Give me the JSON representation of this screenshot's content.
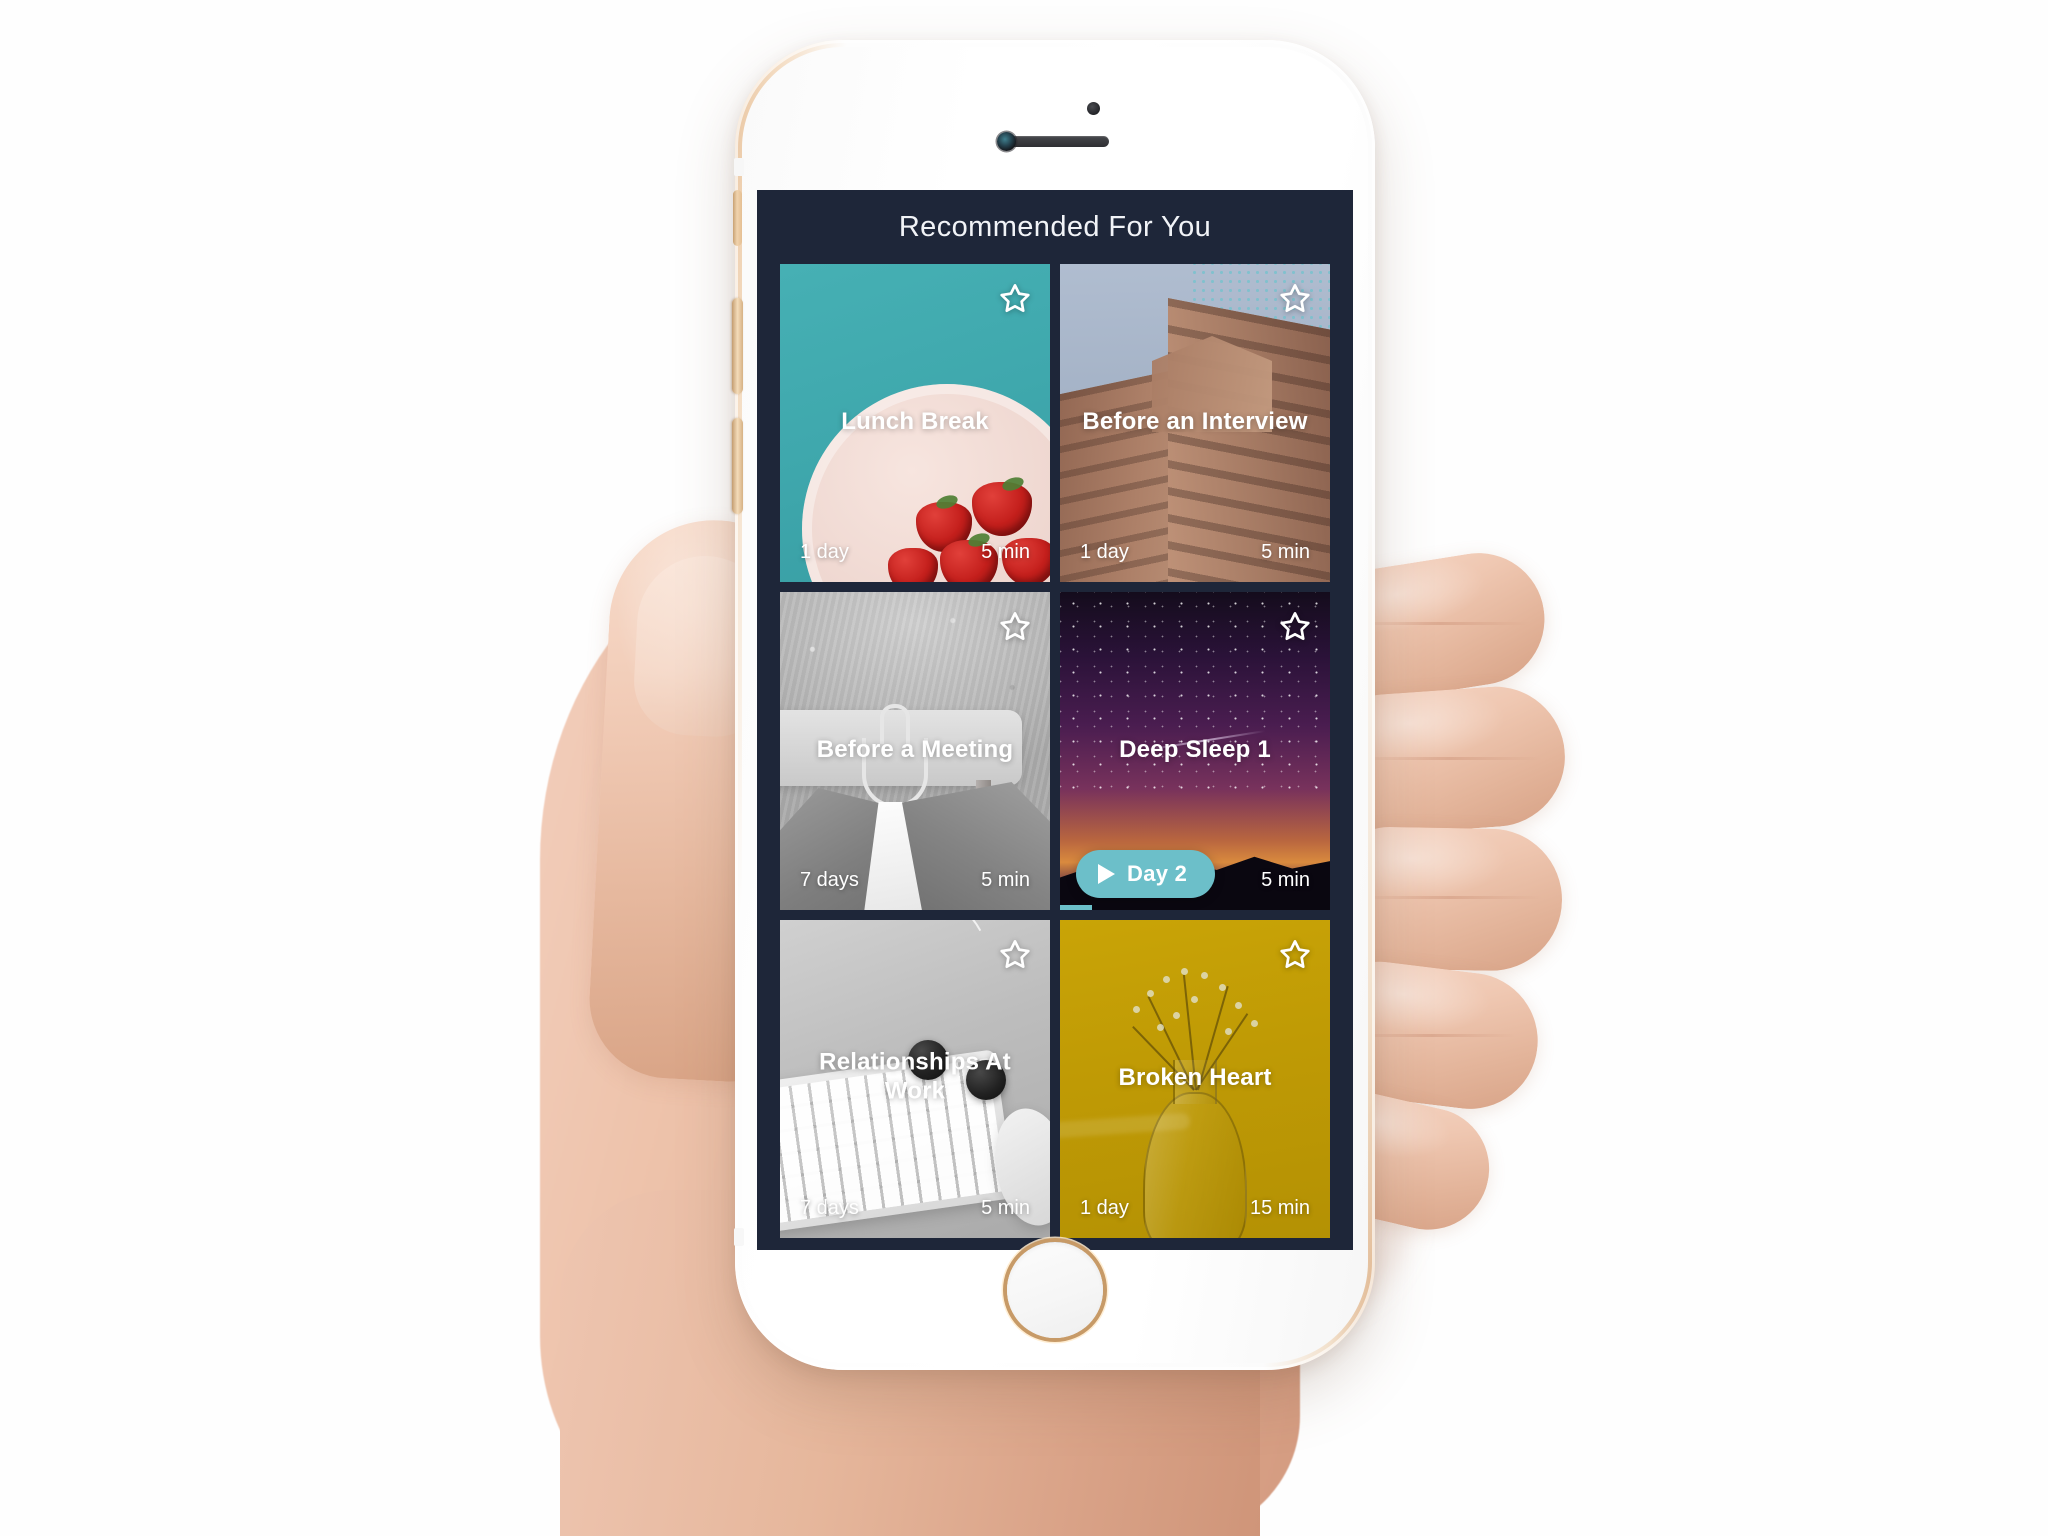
{
  "device": {
    "name": "iphone-gold-white",
    "hardware": {
      "speaker": "earpiece-speaker",
      "camera": "front-camera",
      "sensor": "proximity-sensor",
      "home_button": "home-button",
      "silent_switch": "silent-switch",
      "volume_up": "volume-up-button",
      "volume_down": "volume-down-button"
    }
  },
  "app": {
    "header": {
      "title": "Recommended For You"
    },
    "theme": {
      "background": "#1e2639",
      "accent_teal": "#6cbfc9",
      "text_primary": "#ffffff"
    },
    "cards": [
      {
        "id": "lunch-break",
        "title": "Lunch Break",
        "duration_label": "1 day",
        "length_label": "5 min",
        "favorite_icon": "star-outline-icon",
        "background_color": "#3fa8ad",
        "has_day_pill": false,
        "progress_percent": 0
      },
      {
        "id": "before-an-interview",
        "title": "Before an Interview",
        "duration_label": "1 day",
        "length_label": "5 min",
        "favorite_icon": "star-outline-icon",
        "background_color": "#a4b2c6",
        "has_day_pill": false,
        "progress_percent": 0
      },
      {
        "id": "before-a-meeting",
        "title": "Before a Meeting",
        "duration_label": "7 days",
        "length_label": "5 min",
        "favorite_icon": "star-outline-icon",
        "background_color": "#b9b9b9",
        "has_day_pill": false,
        "progress_percent": 0
      },
      {
        "id": "deep-sleep-1",
        "title": "Deep Sleep 1",
        "duration_label": "",
        "length_label": "5 min",
        "favorite_icon": "star-outline-icon",
        "background_color": "#4a1d50",
        "has_day_pill": true,
        "day_pill_label": "Day 2",
        "play_icon": "play-triangle-icon",
        "progress_percent": 12
      },
      {
        "id": "relationships-at-work",
        "title": "Relationships At Work",
        "duration_label": "7 days",
        "length_label": "5 min",
        "favorite_icon": "star-outline-icon",
        "background_color": "#b3b3b3",
        "has_day_pill": false,
        "progress_percent": 0
      },
      {
        "id": "broken-heart",
        "title": "Broken Heart",
        "duration_label": "1 day",
        "length_label": "15 min",
        "favorite_icon": "star-outline-icon",
        "background_color": "#bf9a05",
        "has_day_pill": false,
        "progress_percent": 0
      }
    ]
  }
}
